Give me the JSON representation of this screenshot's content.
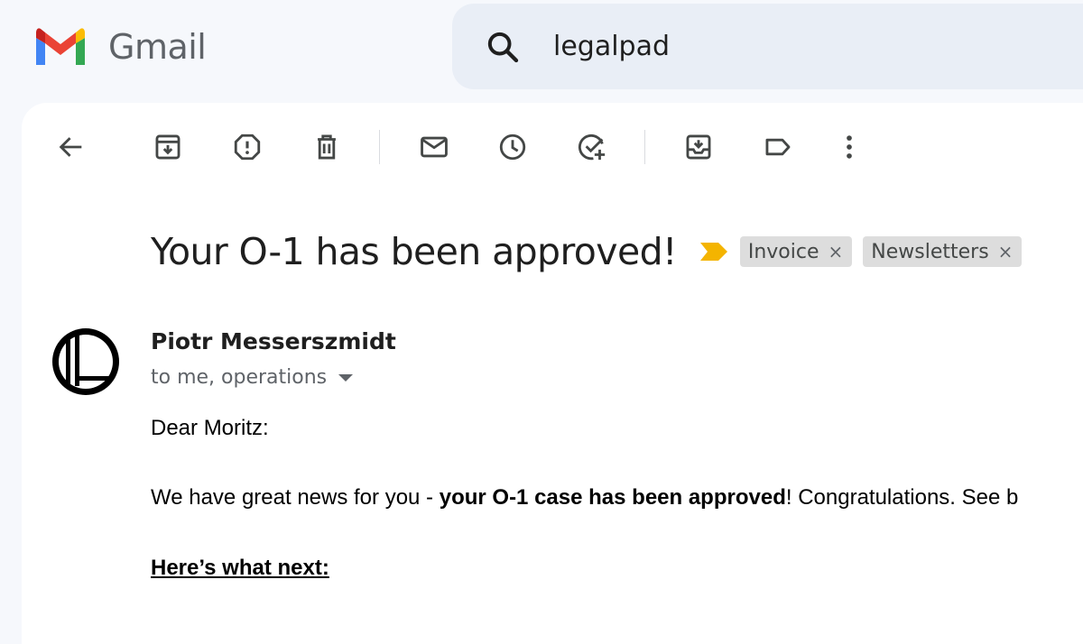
{
  "app": {
    "name": "Gmail"
  },
  "search": {
    "value": "legalpad"
  },
  "toolbar": {
    "buttons": [
      "back-arrow-icon",
      "archive-icon",
      "report-spam-icon",
      "delete-icon",
      "mark-unread-icon",
      "snooze-icon",
      "add-to-tasks-icon",
      "move-to-icon",
      "label-icon",
      "more-vert-icon"
    ]
  },
  "email": {
    "subject": "Your O-1 has been approved!",
    "importance_color": "#f4b400",
    "labels": [
      {
        "name": "Invoice",
        "remove": "×"
      },
      {
        "name": "Newsletters",
        "remove": "×"
      }
    ],
    "sender": "Piotr Messerszmidt",
    "recipients": "to me, operations",
    "greeting": "Dear Moritz:",
    "para_before": "We have great news for you - ",
    "para_bold": "your O-1 case has been approved",
    "para_after": "! Congratulations. See b",
    "next_heading": "Here’s what next:"
  },
  "colors": {
    "background": "#f6f8fc",
    "search_bg": "#e9eef6",
    "icon": "#444746"
  }
}
